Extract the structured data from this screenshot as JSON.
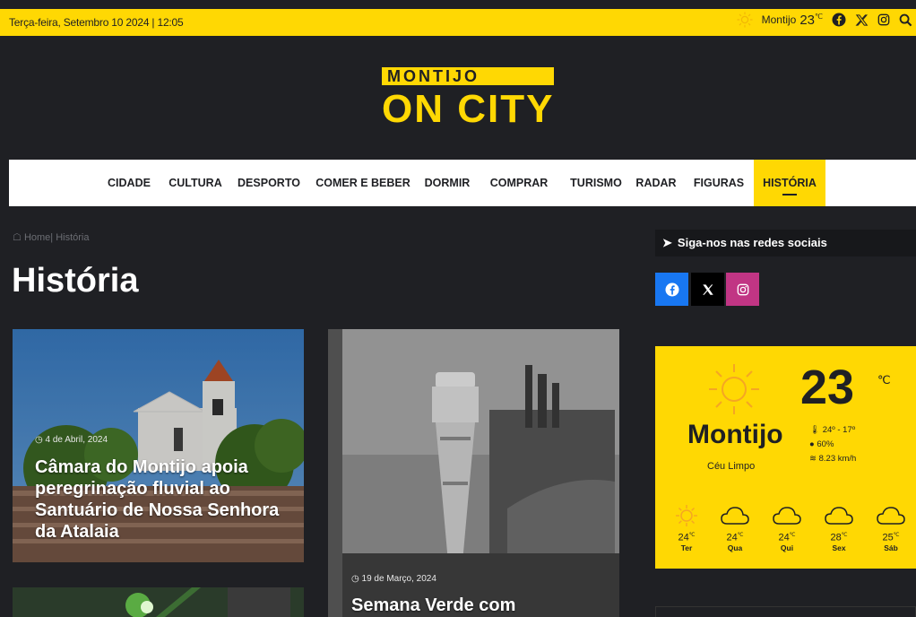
{
  "topbar": {
    "date": "Terça-feira, Setembro 10 2024 | 12:05",
    "city": "Montijo",
    "temp": "23",
    "unit": "℃"
  },
  "logo": {
    "top": "MONTIJO",
    "bottom": "ON CITY"
  },
  "nav": {
    "items": [
      "CIDADE",
      "CULTURA",
      "DESPORTO",
      "COMER E BEBER",
      "DORMIR",
      "COMPRAR",
      "TURISMO",
      "RADAR",
      "FIGURAS",
      "HISTÓRIA"
    ],
    "active": "HISTÓRIA"
  },
  "breadcrumb": {
    "home": "Home",
    "sep": "|",
    "current": "História"
  },
  "page_title": "História",
  "posts": [
    {
      "date": "4 de Abril, 2024",
      "title": "Câmara do Montijo apoia peregrinação fluvial ao Santuário de Nossa Senhora da Atalaia"
    },
    {
      "date": "19 de Março, 2024",
      "title": "Semana Verde com"
    }
  ],
  "sidebar": {
    "social_title": "Siga-nos nas redes sociais",
    "weather": {
      "temp": "23",
      "unit": "℃",
      "city": "Montijo",
      "desc": "Céu Limpo",
      "range": "24º - 17º",
      "humidity": "60%",
      "wind": "8.23 km/h",
      "forecast": [
        {
          "day": "Ter",
          "temp": "24",
          "icon": "sun-icon"
        },
        {
          "day": "Qua",
          "temp": "24",
          "icon": "cloud-icon"
        },
        {
          "day": "Qui",
          "temp": "24",
          "icon": "cloud-icon"
        },
        {
          "day": "Sex",
          "temp": "28",
          "icon": "cloud-icon"
        },
        {
          "day": "Sáb",
          "temp": "25",
          "icon": "cloud-icon"
        }
      ]
    }
  },
  "colors": {
    "accent": "#ffd803",
    "background": "#1f2024",
    "facebook": "#1877f2",
    "x": "#000000",
    "instagram": "#c13584"
  }
}
